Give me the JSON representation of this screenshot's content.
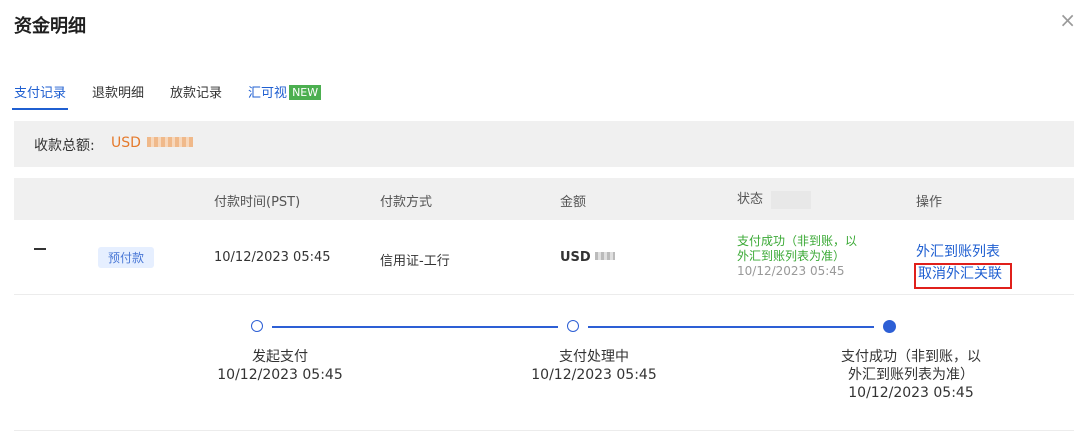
{
  "dialog": {
    "title": "资金明细",
    "close_icon": "×"
  },
  "tabs": [
    {
      "label": "支付记录",
      "active": true
    },
    {
      "label": "退款明细"
    },
    {
      "label": "放款记录"
    },
    {
      "label": "汇可视",
      "badge": "NEW"
    }
  ],
  "summary": {
    "label": "收款总额:",
    "currency": "USD"
  },
  "table": {
    "headers": [
      "付款时间(PST)",
      "付款方式",
      "金额",
      "状态",
      "操作"
    ],
    "row": {
      "tag": "预付款",
      "time": "10/12/2023 05:45",
      "method": "信用证-工行",
      "amount_currency": "USD",
      "status_line1": "支付成功（非到账，以",
      "status_line2": "外汇到账列表为准）",
      "status_time": "10/12/2023 05:45",
      "op1": "外汇到账列表",
      "op2": "取消外汇关联"
    }
  },
  "timeline": [
    {
      "label": "发起支付",
      "time": "10/12/2023 05:45"
    },
    {
      "label": "支付处理中",
      "time": "10/12/2023 05:45"
    },
    {
      "label": "支付成功（非到账，以",
      "label2": "外汇到账列表为准）",
      "time": "10/12/2023 05:45"
    }
  ],
  "colors": {
    "accent": "#1f5fd1",
    "success": "#3aa935",
    "amount": "#e57a2c",
    "highlight_border": "#e0201b"
  }
}
